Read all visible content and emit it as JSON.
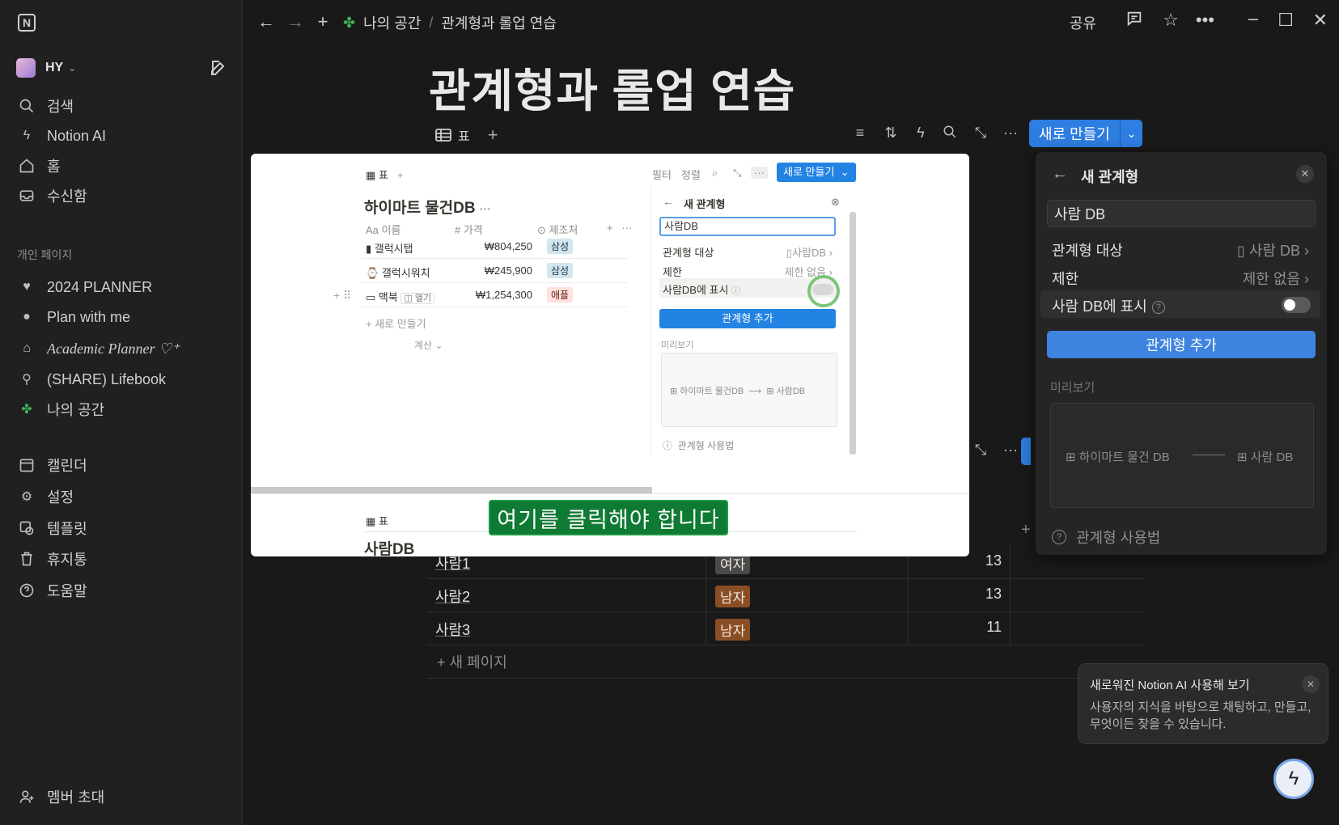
{
  "sidebar": {
    "logo": "N",
    "workspace": "HY",
    "nav": [
      "검색",
      "Notion AI",
      "홈",
      "수신함"
    ],
    "section_label": "개인 페이지",
    "pages": [
      "2024 PLANNER",
      "Plan with me",
      "Academic Planner ♡⁺",
      "(SHARE) Lifebook",
      "나의 공간"
    ],
    "tools": [
      "캘린더",
      "설정",
      "템플릿",
      "휴지통",
      "도움말"
    ],
    "invite": "멤버 초대"
  },
  "topbar": {
    "breadcrumb_root": "나의 공간",
    "breadcrumb_sep": "/",
    "breadcrumb_page": "관계형과 롤업 연습",
    "share": "공유"
  },
  "page": {
    "title": "관계형과 롤업 연습",
    "view_tab": "표",
    "new_button": "새로 만들기",
    "rows": [
      {
        "name": "사람1",
        "tag": "여자",
        "age": "13",
        "tag_kind": "female"
      },
      {
        "name": "사람2",
        "tag": "남자",
        "age": "13",
        "tag_kind": "male"
      },
      {
        "name": "사람3",
        "tag": "남자",
        "age": "11",
        "tag_kind": "male"
      }
    ],
    "new_page": "+ 새 페이지"
  },
  "relation_panel": {
    "title": "새 관계형",
    "name_value": "사람 DB",
    "target_label": "관계형 대상",
    "target_value": "사람 DB",
    "limit_label": "제한",
    "limit_value": "제한 없음",
    "show_label": "사람 DB에 표시",
    "add_button": "관계형 추가",
    "preview_label": "미리보기",
    "preview_from": "하이마트 물건 DB",
    "preview_to": "사람 DB",
    "howto": "관계형 사용법"
  },
  "overlay": {
    "tab": "표",
    "tools": [
      "필터",
      "정렬"
    ],
    "new_button": "새로 만들기",
    "db_title": "하이마트 물건DB",
    "headers": [
      "Aa 이름",
      "# 가격",
      "제조처"
    ],
    "rows": [
      {
        "name": "갤럭시탭",
        "price": "₩804,250",
        "maker": "삼성",
        "kind": "blue"
      },
      {
        "name": "갤럭시워치",
        "price": "₩245,900",
        "maker": "삼성",
        "kind": "blue"
      },
      {
        "name": "맥북",
        "price": "₩1,254,300",
        "maker": "애플",
        "kind": "red"
      }
    ],
    "open_chip": "열기",
    "new_row": "+ 새로 만들기",
    "calc": "계산 ⌄",
    "panel_title": "새 관계형",
    "panel_input": "사람DB",
    "panel_target_label": "관계형 대상",
    "panel_target_value": "사람DB",
    "panel_limit_label": "제한",
    "panel_limit_value": "제한 없음",
    "panel_show_label": "사람DB에 표시",
    "panel_add": "관계형 추가",
    "panel_preview": "미리보기",
    "panel_preview_from": "하이마트 물건DB",
    "panel_preview_to": "사람DB",
    "panel_howto": "관계형 사용법",
    "tab2": "표",
    "db2_title": "사람DB",
    "callout": "여기를 클릭해야 합니다"
  },
  "ai_popup": {
    "title": "새로워진 Notion AI 사용해 보기",
    "body": "사용자의 지식을 바탕으로 채팅하고, 만들고, 무엇이든 찾을 수 있습니다."
  }
}
